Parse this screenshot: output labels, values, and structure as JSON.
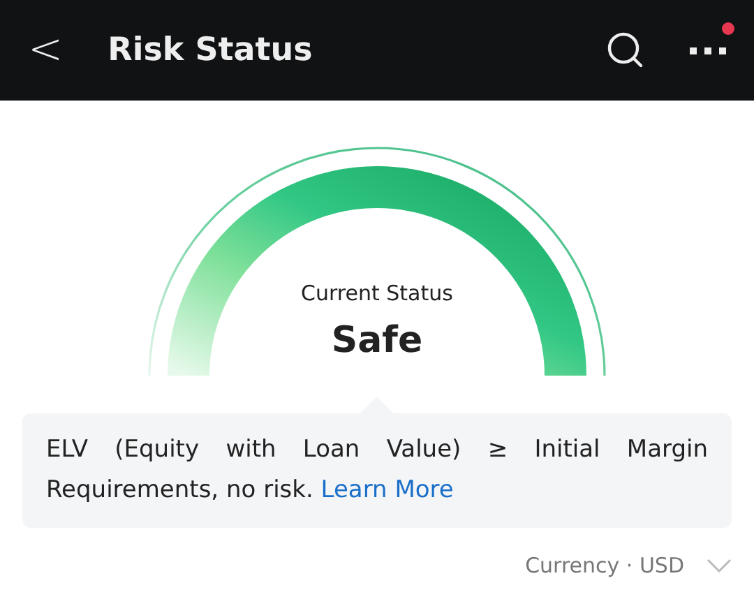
{
  "header": {
    "back": "<",
    "title": "Risk Status",
    "notification_dot": true
  },
  "gauge": {
    "label": "Current Status",
    "status": "Safe"
  },
  "info": {
    "text": "ELV (Equity with Loan Value) ≥ Initial Margin Requirements, no risk.",
    "link": "Learn More"
  },
  "currency": {
    "label": "Currency · USD"
  }
}
